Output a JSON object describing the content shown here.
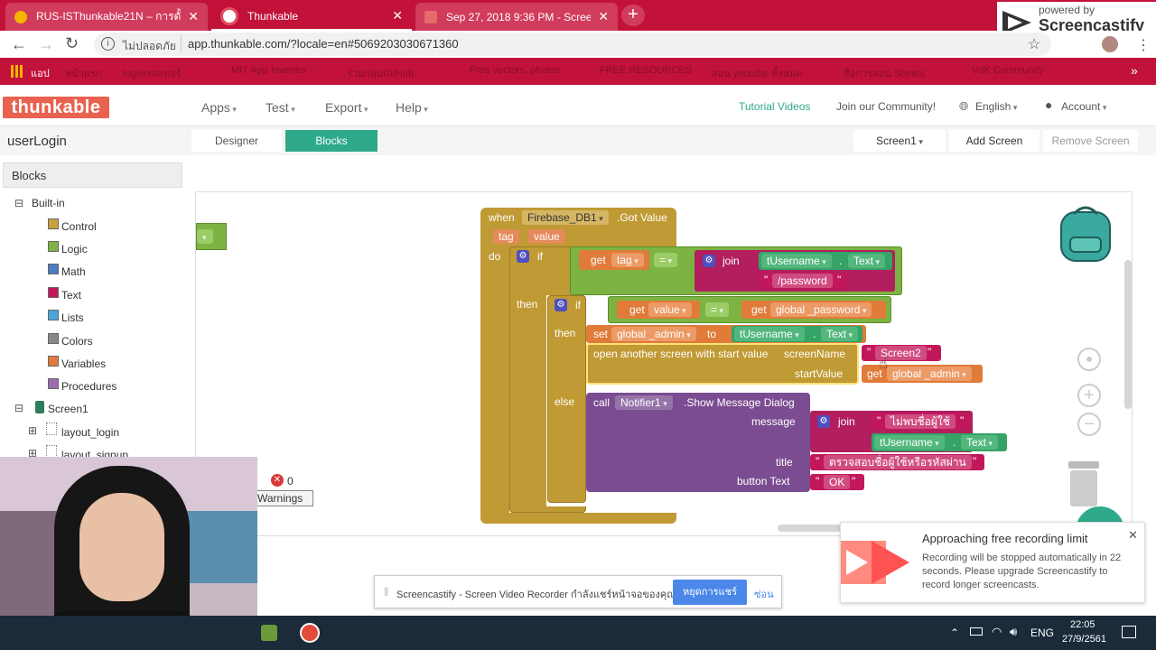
{
  "browser": {
    "tabs": [
      {
        "label": "RUS-ISThunkable21N – การตั้งค่า"
      },
      {
        "label": "Thunkable"
      },
      {
        "label": "Sep 27, 2018 9:36 PM - Screencast"
      }
    ],
    "new_tab": "+",
    "insecure_label": "ไม่ปลอดภัย",
    "url": "app.thunkable.com/?locale=en#5069203030671360",
    "bookmarks": [
      "แอป",
      "หน้าแรก",
      "loginเทสเทอร์",
      "MIT App Inventor",
      "ร่วมกลุ่มGitHub",
      "Free vectors, photos",
      "FREE RESOURCES",
      "สอน youtube ทั้งหมด",
      "สื่อการสอน Sheets",
      "VdK Community"
    ],
    "screencastify_badge_small": "powered by",
    "screencastify_badge": "Screencastify"
  },
  "app": {
    "logo": "thunkable",
    "menus": [
      "Apps",
      "Test",
      "Export",
      "Help"
    ],
    "tutorial": "Tutorial Videos",
    "community": "Join our Community!",
    "language": "English",
    "account": "Account",
    "project_name": "userLogin",
    "tab_designer": "Designer",
    "tab_blocks": "Blocks",
    "screen_select": "Screen1",
    "add_screen": "Add Screen",
    "remove_screen": "Remove Screen"
  },
  "blocks_panel": {
    "header": "Blocks",
    "builtin": "Built-in",
    "categories": [
      {
        "label": "Control",
        "color": "#c8a040"
      },
      {
        "label": "Logic",
        "color": "#7cb342"
      },
      {
        "label": "Math",
        "color": "#4a7dbf"
      },
      {
        "label": "Text",
        "color": "#c2185b"
      },
      {
        "label": "Lists",
        "color": "#4aa6d8"
      },
      {
        "label": "Colors",
        "color": "#888888"
      },
      {
        "label": "Variables",
        "color": "#e07b39"
      },
      {
        "label": "Procedures",
        "color": "#9c6bb0"
      }
    ],
    "screen": "Screen1",
    "components": [
      "layout_login",
      "layout_signup"
    ],
    "warnings_count": "0",
    "warnings_label": "Warnings"
  },
  "code": {
    "when": "when",
    "component": "Firebase_DB1",
    "event": ".Got Value",
    "param_tag": "tag",
    "param_value": "value",
    "do": "do",
    "if": "if",
    "then": "then",
    "else": "else",
    "get": "get",
    "set": "set",
    "to": "to",
    "join": "join",
    "eq": "=",
    "tag": "tag",
    "value": "value",
    "tUsername": "tUsername",
    "text_prop": "Text",
    "dot": ".",
    "password_str": "/password",
    "global_password": "global _password",
    "global_admin": "global _admin",
    "open_screen": "open another screen with start value",
    "screenName": "screenName",
    "screen2": "Screen2",
    "startValue": "startValue",
    "call": "call",
    "notifier": "Notifier1",
    "show_msg": ".Show Message Dialog",
    "message": "message",
    "msg_str": "ไม่พบชื่อผู้ใช้",
    "title": "title",
    "title_str": "ตรวจสอบชื่อผู้ใช้หรือรหัสผ่าน",
    "button_text": "button Text",
    "ok": "OK",
    "quote_open": "\"",
    "quote_close": "\""
  },
  "notification": {
    "title": "Approaching free recording limit",
    "body": "Recording will be stopped automatically in 22 seconds. Please upgrade Screencastify to record longer screencasts."
  },
  "sharebar": {
    "text": "Screencastify - Screen Video Recorder กำลังแชร์หน้าจอของคุณ",
    "stop": "หยุดการแชร์",
    "hide": "ซ่อน"
  },
  "taskbar": {
    "lang": "ENG",
    "time": "22:05",
    "date": "27/9/2561"
  }
}
